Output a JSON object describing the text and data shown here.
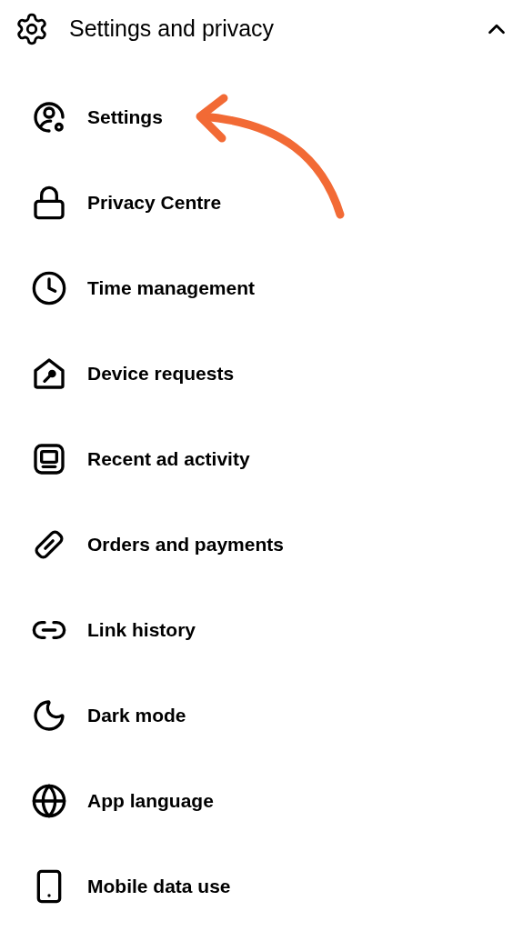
{
  "section": {
    "title": "Settings and privacy",
    "expanded": true
  },
  "items": [
    {
      "label": "Settings"
    },
    {
      "label": "Privacy Centre"
    },
    {
      "label": "Time management"
    },
    {
      "label": "Device requests"
    },
    {
      "label": "Recent ad activity"
    },
    {
      "label": "Orders and payments"
    },
    {
      "label": "Link history"
    },
    {
      "label": "Dark mode"
    },
    {
      "label": "App language"
    },
    {
      "label": "Mobile data use"
    }
  ]
}
